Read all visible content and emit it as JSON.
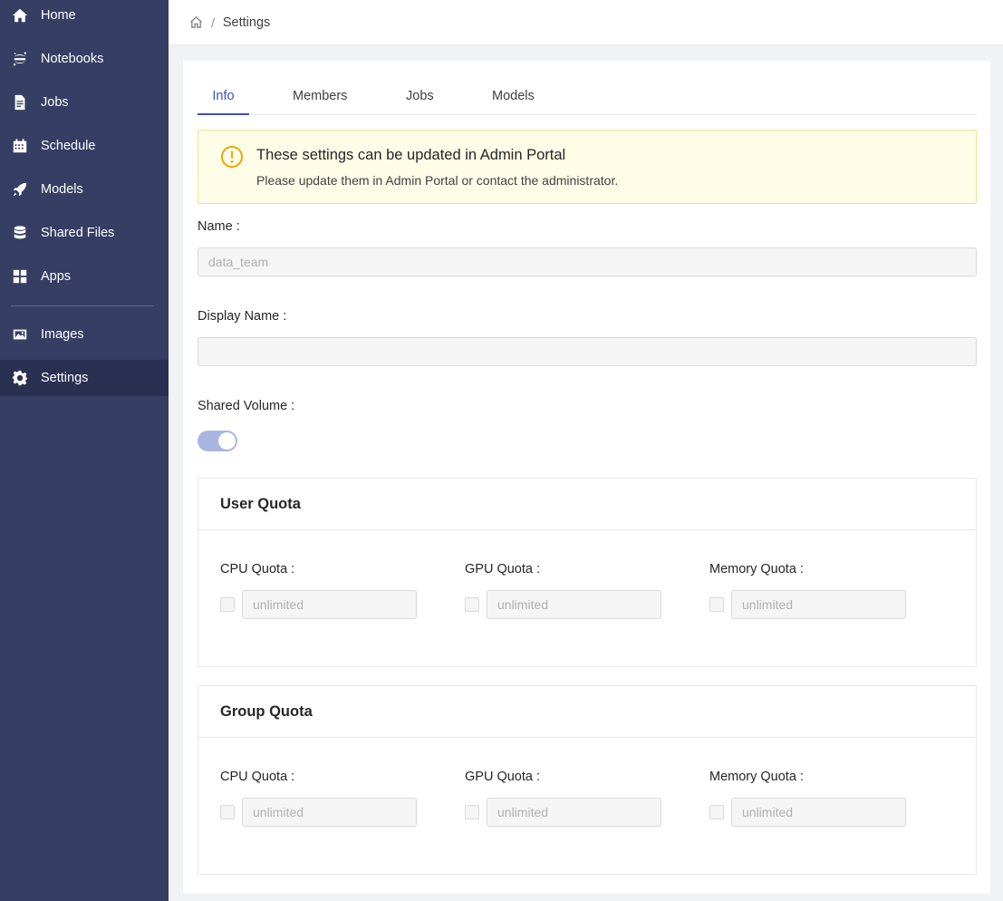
{
  "sidebar": {
    "items": [
      {
        "label": "Home",
        "icon": "home-icon"
      },
      {
        "label": "Notebooks",
        "icon": "jupyter-icon"
      },
      {
        "label": "Jobs",
        "icon": "document-icon"
      },
      {
        "label": "Schedule",
        "icon": "calendar-icon"
      },
      {
        "label": "Models",
        "icon": "rocket-icon"
      },
      {
        "label": "Shared Files",
        "icon": "database-icon"
      },
      {
        "label": "Apps",
        "icon": "grid-icon"
      },
      {
        "label": "Images",
        "icon": "image-icon"
      },
      {
        "label": "Settings",
        "icon": "gear-icon"
      }
    ],
    "active": "Settings",
    "background": "#373e63"
  },
  "breadcrumb": {
    "separator": "/",
    "current": "Settings"
  },
  "tabs": [
    "Info",
    "Members",
    "Jobs",
    "Models"
  ],
  "active_tab": "Info",
  "accent_color": "#3f51b5",
  "alert": {
    "title": "These settings can be updated in Admin Portal",
    "description": "Please update them in Admin Portal or contact the administrator."
  },
  "form": {
    "name_label": "Name",
    "name_placeholder": "data_team",
    "display_name_label": "Display Name",
    "display_name_placeholder": "",
    "shared_volume_label": "Shared Volume",
    "shared_volume_on": true,
    "colon": ":"
  },
  "user_quota": {
    "title": "User Quota",
    "cpu_label": "CPU Quota",
    "gpu_label": "GPU Quota",
    "memory_label": "Memory Quota",
    "placeholder": "unlimited"
  },
  "group_quota": {
    "title": "Group Quota",
    "cpu_label": "CPU Quota",
    "gpu_label": "GPU Quota",
    "memory_label": "Memory Quota",
    "placeholder": "unlimited"
  }
}
